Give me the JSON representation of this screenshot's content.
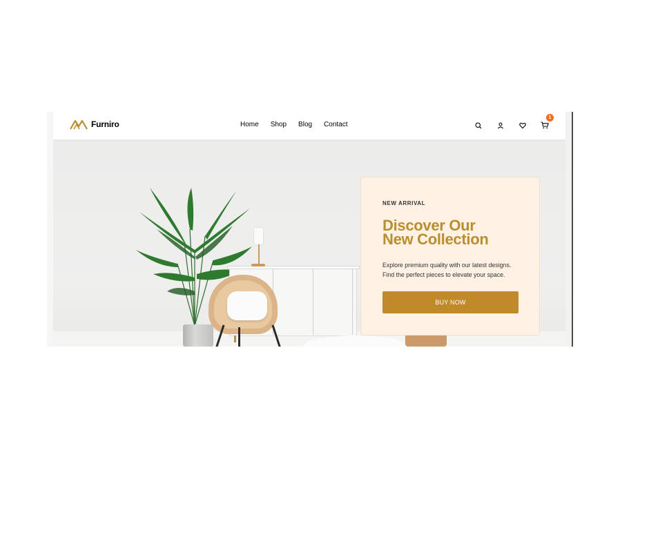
{
  "brand": {
    "name": "Furniro",
    "logo_color": "#B88E2F"
  },
  "nav": {
    "items": [
      {
        "label": "Home"
      },
      {
        "label": "Shop"
      },
      {
        "label": "Blog"
      },
      {
        "label": "Contact"
      }
    ]
  },
  "header_icons": {
    "search": "search-icon",
    "account": "user-icon",
    "wishlist": "heart-icon",
    "cart": "cart-icon",
    "cart_count": "1",
    "badge_color": "#F26D21"
  },
  "hero": {
    "eyebrow": "NEW ARRIVAL",
    "title_line1": "Discover Our",
    "title_line2": "New Collection",
    "desc_line1": "Explore premium quality with our latest designs.",
    "desc_line2": "Find the perfect pieces to elevate your space.",
    "cta_label": "BUY NOW",
    "accent_color": "#B88E2F",
    "card_bg": "#FFF1E3"
  }
}
